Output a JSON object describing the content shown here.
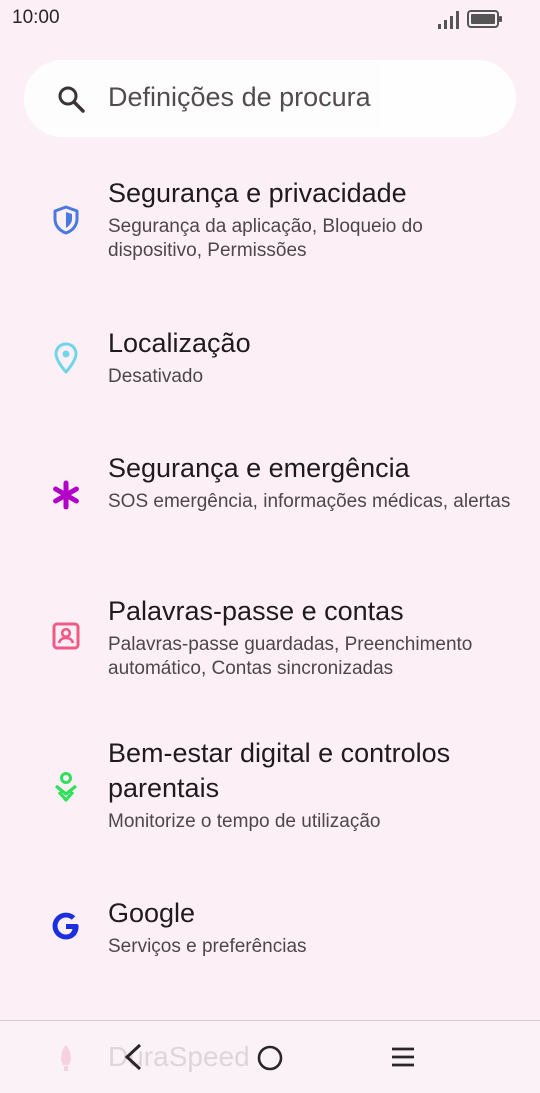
{
  "status_bar": {
    "time": "10:00",
    "signal_icon": "signal-icon",
    "battery_icon": "battery-icon"
  },
  "search": {
    "placeholder": "Definições de procura",
    "icon": "search-icon"
  },
  "settings": {
    "items": [
      {
        "title": "Segurança e privacidade",
        "subtitle": "Segurança da aplicação, Bloqueio do dispositivo, Permissões",
        "icon": "shield-icon",
        "color": "#4a79e0"
      },
      {
        "title": "Localização",
        "subtitle": "Desativado",
        "icon": "location-pin-icon",
        "color": "#6fd6e8"
      },
      {
        "title": "Segurança e emergência",
        "subtitle": "SOS emergência, informações médicas, alertas",
        "icon": "asterisk-icon",
        "color": "#b300c8"
      },
      {
        "title": "Palavras-passe e contas",
        "subtitle": "Palavras-passe guardadas, Preenchimento automático, Contas sincronizadas",
        "icon": "account-box-icon",
        "color": "#f05a86"
      },
      {
        "title": "Bem-estar digital e controlos parentais",
        "subtitle": "Monitorize o tempo de utilização",
        "icon": "wellbeing-icon",
        "color": "#2fe05a"
      },
      {
        "title": "Google",
        "subtitle": "Serviços e preferências",
        "icon": "google-icon",
        "color": "#1c2fe0"
      }
    ]
  },
  "nav_bar": {
    "watermark": "DuraSpeed",
    "back_icon": "back-chevron-icon",
    "home_icon": "home-circle-icon",
    "menu_icon": "menu-icon"
  }
}
